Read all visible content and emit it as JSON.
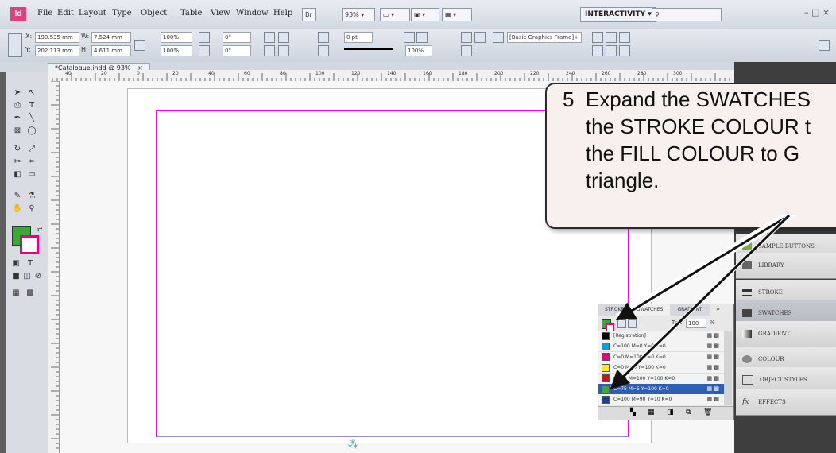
{
  "menubar": {
    "app_logo": "Id",
    "items": [
      "File",
      "Edit",
      "Layout",
      "Type",
      "Object",
      "Table",
      "View",
      "Window",
      "Help"
    ],
    "zoom": "93%",
    "workspace": "INTERACTIVITY",
    "window_controls": "– □ ×"
  },
  "controlbar": {
    "x_label": "X:",
    "x_value": "190.535 mm",
    "y_label": "Y:",
    "y_value": "202.113 mm",
    "w_label": "W:",
    "w_value": "7.524 mm",
    "h_label": "H:",
    "h_value": "4.611 mm",
    "scale_x": "100%",
    "scale_y": "100%",
    "rotate": "0°",
    "shear": "0°",
    "stroke_weight": "0 pt",
    "opacity": "100%",
    "frame_style": "[Basic Graphics Frame]+"
  },
  "document": {
    "tab_label": "*Catalogue.indd @ 93%",
    "close": "×"
  },
  "ruler": {
    "ticks": [
      "40",
      "20",
      "0",
      "20",
      "40",
      "60",
      "80",
      "100",
      "120",
      "140",
      "160",
      "180",
      "200",
      "220",
      "240",
      "260",
      "280",
      "300"
    ]
  },
  "dock": {
    "items": [
      "SAMPLE BUTTONS",
      "LIBRARY",
      "STROKE",
      "SWATCHES",
      "GRADIENT",
      "COLOUR",
      "OBJECT STYLES",
      "EFFECTS"
    ]
  },
  "swatches_panel": {
    "tabs": [
      "STROKE",
      "SWATCHES",
      "GRADIENT"
    ],
    "tint_label": "Tint:",
    "tint_value": "100",
    "tint_unit": "%",
    "rows": [
      {
        "name": "[Registration]",
        "color": "#000000"
      },
      {
        "name": "C=100 M=0 Y=0 K=0",
        "color": "#00a0e0"
      },
      {
        "name": "C=0 M=100 Y=0 K=0",
        "color": "#e4007f"
      },
      {
        "name": "C=0 M=0 Y=100 K=0",
        "color": "#fff100"
      },
      {
        "name": "C=15 M=100 Y=100 K=0",
        "color": "#c8161e"
      },
      {
        "name": "C=75 M=5 Y=100 K=0",
        "color": "#3aa935",
        "selected": true
      },
      {
        "name": "C=100 M=90 Y=10 K=0",
        "color": "#1d3d8f"
      }
    ]
  },
  "callout": {
    "text": "5  Expand the SWATCHES\n    the STROKE COLOUR t\n    the FILL COLOUR to G\n    triangle."
  },
  "colors": {
    "fill_swatch": "#3aa935",
    "stroke_swatch": "#e4007f",
    "margin_guide": "#ff00ff"
  }
}
